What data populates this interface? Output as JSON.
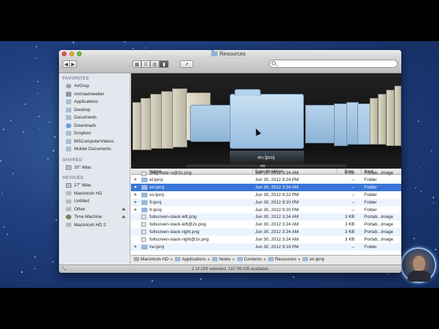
{
  "window": {
    "title": "Resources"
  },
  "toolbar": {
    "back": "◀",
    "forward": "▶",
    "views": [
      "icon-view",
      "list-view",
      "column-view",
      "cover-flow-view"
    ],
    "action": "↗",
    "search_placeholder": ""
  },
  "sidebar": {
    "sections": [
      {
        "label": "FAVORITES",
        "items": [
          {
            "label": "AirDrop",
            "icon": "airdrop-icon"
          },
          {
            "label": "michaelsteeber",
            "icon": "home-icon"
          },
          {
            "label": "Applications",
            "icon": "applications-icon"
          },
          {
            "label": "Desktop",
            "icon": "desktop-icon"
          },
          {
            "label": "Documents",
            "icon": "documents-icon"
          },
          {
            "label": "Downloads",
            "icon": "downloads-icon"
          },
          {
            "label": "Dropbox",
            "icon": "folder-icon"
          },
          {
            "label": "MSComputerVideos",
            "icon": "folder-icon"
          },
          {
            "label": "Mobile Documents",
            "icon": "folder-icon"
          }
        ]
      },
      {
        "label": "SHARED",
        "items": [
          {
            "label": "20\" iMac",
            "icon": "monitor-icon"
          }
        ]
      },
      {
        "label": "DEVICES",
        "items": [
          {
            "label": "27\" iMac",
            "icon": "monitor-icon"
          },
          {
            "label": "Macintosh HD",
            "icon": "drive-icon"
          },
          {
            "label": "Untitled",
            "icon": "drive-icon"
          },
          {
            "label": "Other",
            "icon": "drive-icon",
            "eject": "⏏"
          },
          {
            "label": "Time Machine",
            "icon": "time-machine-icon",
            "eject": "⏏"
          },
          {
            "label": "Macintosh HD 2",
            "icon": "drive-icon"
          }
        ]
      }
    ]
  },
  "coverflow": {
    "selected_label": "en.lproj"
  },
  "list": {
    "columns": {
      "name": "Name",
      "date": "Date Modified",
      "size": "Size",
      "kind": "Kind"
    },
    "partial_row": {
      "name": "drag-note~s@2x.png",
      "date": "Jun 30, 2012 3:24 AM",
      "size": "6 KB",
      "kind": "Portab...image"
    },
    "rows": [
      {
        "name": "el.lproj",
        "date": "Jun 30, 2012 9:24 PM",
        "size": "--",
        "kind": "Folder",
        "type": "folder"
      },
      {
        "name": "en.lproj",
        "date": "Jun 30, 2012 3:24 AM",
        "size": "--",
        "kind": "Folder",
        "type": "folder",
        "selected": true
      },
      {
        "name": "es.lproj",
        "date": "Jun 30, 2012 9:22 PM",
        "size": "--",
        "kind": "Folder",
        "type": "folder"
      },
      {
        "name": "fi.lproj",
        "date": "Jun 30, 2012 9:20 PM",
        "size": "--",
        "kind": "Folder",
        "type": "folder"
      },
      {
        "name": "fr.lproj",
        "date": "Jun 30, 2012 9:20 PM",
        "size": "--",
        "kind": "Folder",
        "type": "folder"
      },
      {
        "name": "fullscreen-stack-left.png",
        "date": "Jun 30, 2012 3:24 AM",
        "size": "3 KB",
        "kind": "Portab...image",
        "type": "doc"
      },
      {
        "name": "fullscreen-stack-left@2x.png",
        "date": "Jun 30, 2012 3:24 AM",
        "size": "3 KB",
        "kind": "Portab...image",
        "type": "doc"
      },
      {
        "name": "fullscreen-stack-right.png",
        "date": "Jun 30, 2012 3:24 AM",
        "size": "3 KB",
        "kind": "Portab...image",
        "type": "doc"
      },
      {
        "name": "fullscreen-stack-right@2x.png",
        "date": "Jun 30, 2012 3:24 AM",
        "size": "3 KB",
        "kind": "Portab...image",
        "type": "doc"
      },
      {
        "name": "he.lproj",
        "date": "Jun 30, 2012 9:18 PM",
        "size": "--",
        "kind": "Folder",
        "type": "folder"
      }
    ]
  },
  "pathbar": [
    "Macintosh HD",
    "Applications",
    "Notes",
    "Contents",
    "Resources",
    "en.lproj"
  ],
  "status": {
    "text": "1 of 199 selected, 167.99 GB available"
  },
  "colors": {
    "selection": "#3875d7",
    "sidebar_bg": "#e3e8ef",
    "desktop": "#1f3f7e"
  }
}
